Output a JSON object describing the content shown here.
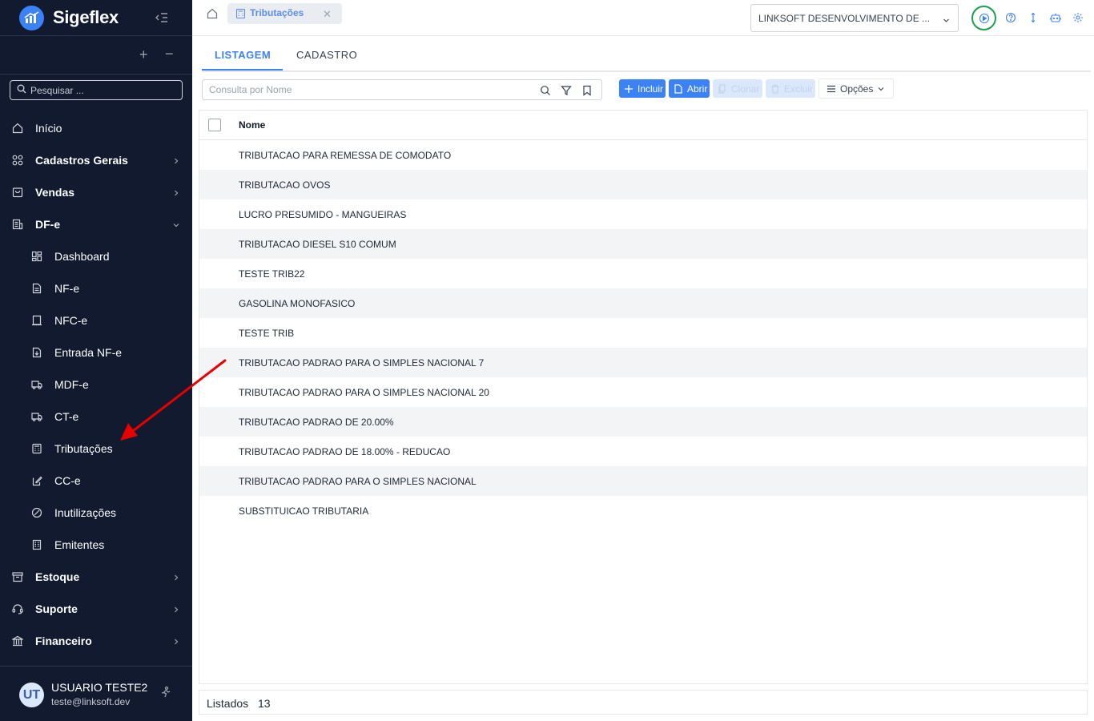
{
  "brand": {
    "name": "Sigeflex"
  },
  "sidebar": {
    "search_placeholder": "Pesquisar ...",
    "tree_expand": "+",
    "tree_collapse": "−",
    "items": [
      {
        "label": "Início",
        "icon": "home-icon"
      },
      {
        "label": "Cadastros Gerais",
        "icon": "apps-icon"
      },
      {
        "label": "Vendas",
        "icon": "shopping-bag-icon"
      },
      {
        "label": "DF-e",
        "icon": "document-list-icon"
      },
      {
        "label": "Dashboard",
        "icon": "dashboard-icon"
      },
      {
        "label": "NF-e",
        "icon": "file-icon"
      },
      {
        "label": "NFC-e",
        "icon": "receipt-icon"
      },
      {
        "label": "Entrada NF-e",
        "icon": "file-import-icon"
      },
      {
        "label": "MDF-e",
        "icon": "truck-icon"
      },
      {
        "label": "CT-e",
        "icon": "truck-icon"
      },
      {
        "label": "Tributações",
        "icon": "calculator-icon"
      },
      {
        "label": "CC-e",
        "icon": "file-edit-icon"
      },
      {
        "label": "Inutilizações",
        "icon": "ban-icon"
      },
      {
        "label": "Emitentes",
        "icon": "building-icon"
      },
      {
        "label": "Estoque",
        "icon": "archive-icon"
      },
      {
        "label": "Suporte",
        "icon": "headset-icon"
      },
      {
        "label": "Financeiro",
        "icon": "bank-icon"
      }
    ]
  },
  "user": {
    "initials": "UT",
    "name": "USUARIO TESTE2",
    "email": "teste@linksoft.dev"
  },
  "topbar": {
    "tab_label": "Tributações",
    "tab_close": "✕",
    "company": "LINKSOFT DESENVOLVIMENTO DE ..."
  },
  "subtabs": {
    "list": "LISTAGEM",
    "form": "CADASTRO"
  },
  "query": {
    "placeholder": "Consulta por Nome"
  },
  "actions": {
    "include": "Incluir",
    "open": "Abrir",
    "clone": "Clonar",
    "delete": "Excluir",
    "options": "Opções"
  },
  "table": {
    "column": "Nome",
    "rows": [
      "TRIBUTACAO PARA REMESSA DE COMODATO",
      "TRIBUTACAO OVOS",
      "LUCRO PRESUMIDO - MANGUEIRAS",
      "TRIBUTACAO DIESEL S10 COMUM",
      "TESTE TRIB22",
      "GASOLINA MONOFASICO",
      "TESTE TRIB",
      "TRIBUTACAO PADRAO PARA O SIMPLES NACIONAL 7",
      "TRIBUTACAO PADRAO PARA O SIMPLES NACIONAL 20",
      "TRIBUTACAO PADRAO DE 20.00%",
      "TRIBUTACAO PADRAO DE 18.00% - REDUCAO",
      "TRIBUTACAO PADRAO PARA O SIMPLES NACIONAL",
      "SUBSTITUICAO TRIBUTARIA"
    ]
  },
  "footer": {
    "label": "Listados",
    "count": "13"
  },
  "colors": {
    "sidebar_bg": "#111a2e",
    "accent": "#3b82f6",
    "highlight_ring": "#16a34a",
    "annotation_arrow": "#e60000"
  }
}
